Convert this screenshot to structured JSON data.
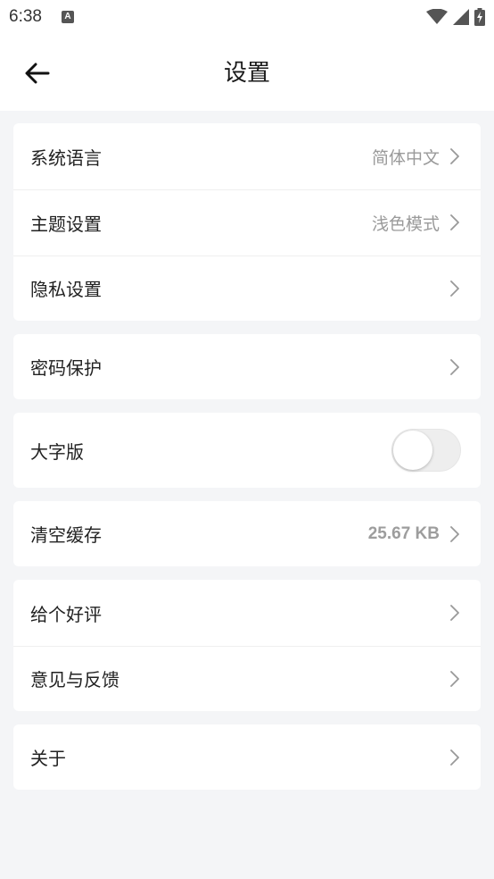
{
  "status_bar": {
    "time": "6:38",
    "notification_badge": "A"
  },
  "header": {
    "title": "设置"
  },
  "groups": [
    {
      "items": [
        {
          "label": "系统语言",
          "value": "简体中文"
        },
        {
          "label": "主题设置",
          "value": "浅色模式"
        },
        {
          "label": "隐私设置",
          "value": ""
        }
      ]
    },
    {
      "items": [
        {
          "label": "密码保护",
          "value": ""
        }
      ]
    },
    {
      "items": [
        {
          "label": "大字版",
          "toggle_on": false
        }
      ]
    },
    {
      "items": [
        {
          "label": "清空缓存",
          "value": "25.67 KB"
        }
      ]
    },
    {
      "items": [
        {
          "label": "给个好评",
          "value": ""
        },
        {
          "label": "意见与反馈",
          "value": ""
        }
      ]
    },
    {
      "items": [
        {
          "label": "关于",
          "value": ""
        }
      ]
    }
  ],
  "colors": {
    "background": "#f4f5f7",
    "card": "#ffffff",
    "secondary_text": "#9a9a9a"
  },
  "icons": [
    "back-arrow-icon",
    "wifi-icon",
    "signal-icon",
    "battery-charging-icon",
    "chevron-right-icon"
  ]
}
